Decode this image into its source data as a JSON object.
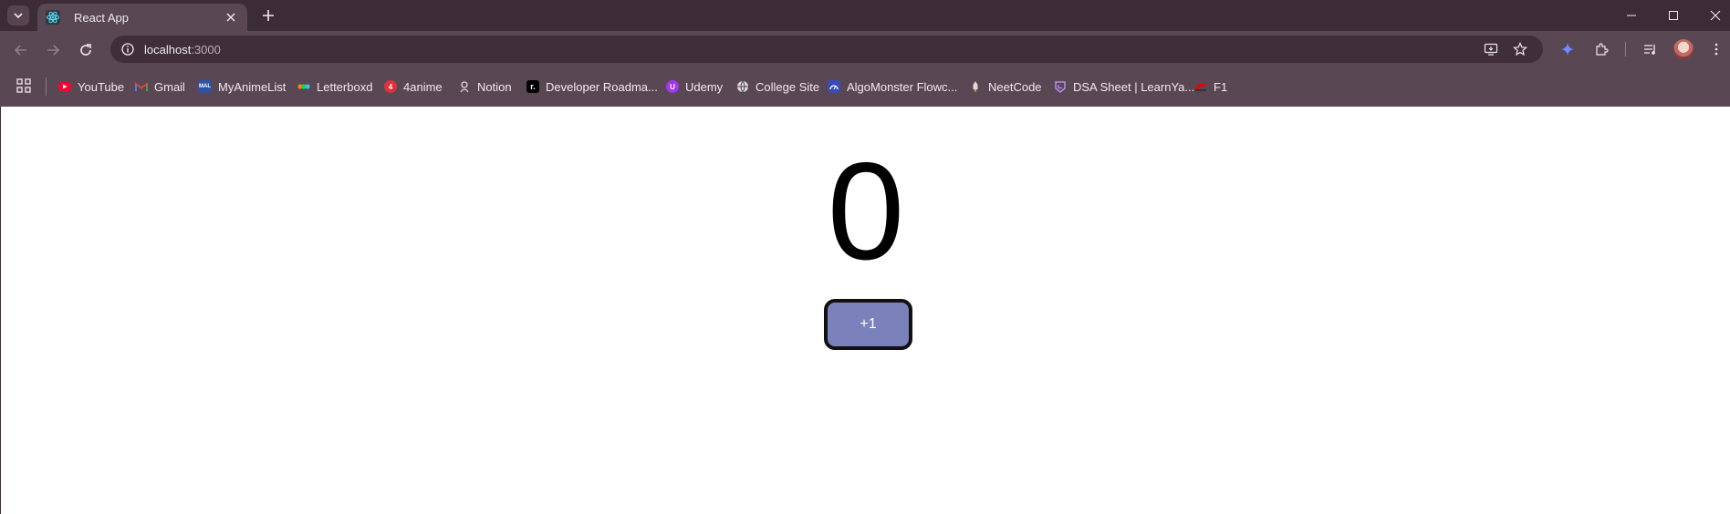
{
  "window": {
    "tab_title": "React App",
    "tab_icon": "react-icon",
    "controls": [
      "minimize-icon",
      "maximize-icon",
      "close-icon"
    ]
  },
  "toolbar": {
    "url_host": "localhost",
    "url_port": ":3000"
  },
  "bookmarks": [
    {
      "label": "YouTube",
      "icon": "youtube-icon",
      "color": "#ff0033"
    },
    {
      "label": "Gmail",
      "icon": "gmail-icon",
      "color": "#ea4335"
    },
    {
      "label": "MyAnimeList",
      "icon": "myanimelist-icon",
      "color": "#2e51a2"
    },
    {
      "label": "Letterboxd",
      "icon": "letterboxd-icon",
      "color": "#40bcf4"
    },
    {
      "label": "4anime",
      "icon": "4anime-icon",
      "color": "#e0323a"
    },
    {
      "label": "Notion",
      "icon": "notion-icon",
      "color": "#e0d8de"
    },
    {
      "label": "Developer Roadma...",
      "icon": "roadmap-icon",
      "color": "#000000"
    },
    {
      "label": "Udemy",
      "icon": "udemy-icon",
      "color": "#a435f0"
    },
    {
      "label": "College Site",
      "icon": "globe-icon",
      "color": "#e0d8de"
    },
    {
      "label": "AlgoMonster Flowc...",
      "icon": "algomonster-icon",
      "color": "#3b4bb8"
    },
    {
      "label": "NeetCode",
      "icon": "neetcode-icon",
      "color": "#f5a623"
    },
    {
      "label": "DSA Sheet | LearnYa...",
      "icon": "learnyard-icon",
      "color": "#8b5cf6"
    },
    {
      "label": "F1",
      "icon": "f1-icon",
      "color": "#e10600"
    }
  ],
  "counter": {
    "value": "0",
    "button_label": "+1",
    "button_color": "#7b82bb"
  }
}
